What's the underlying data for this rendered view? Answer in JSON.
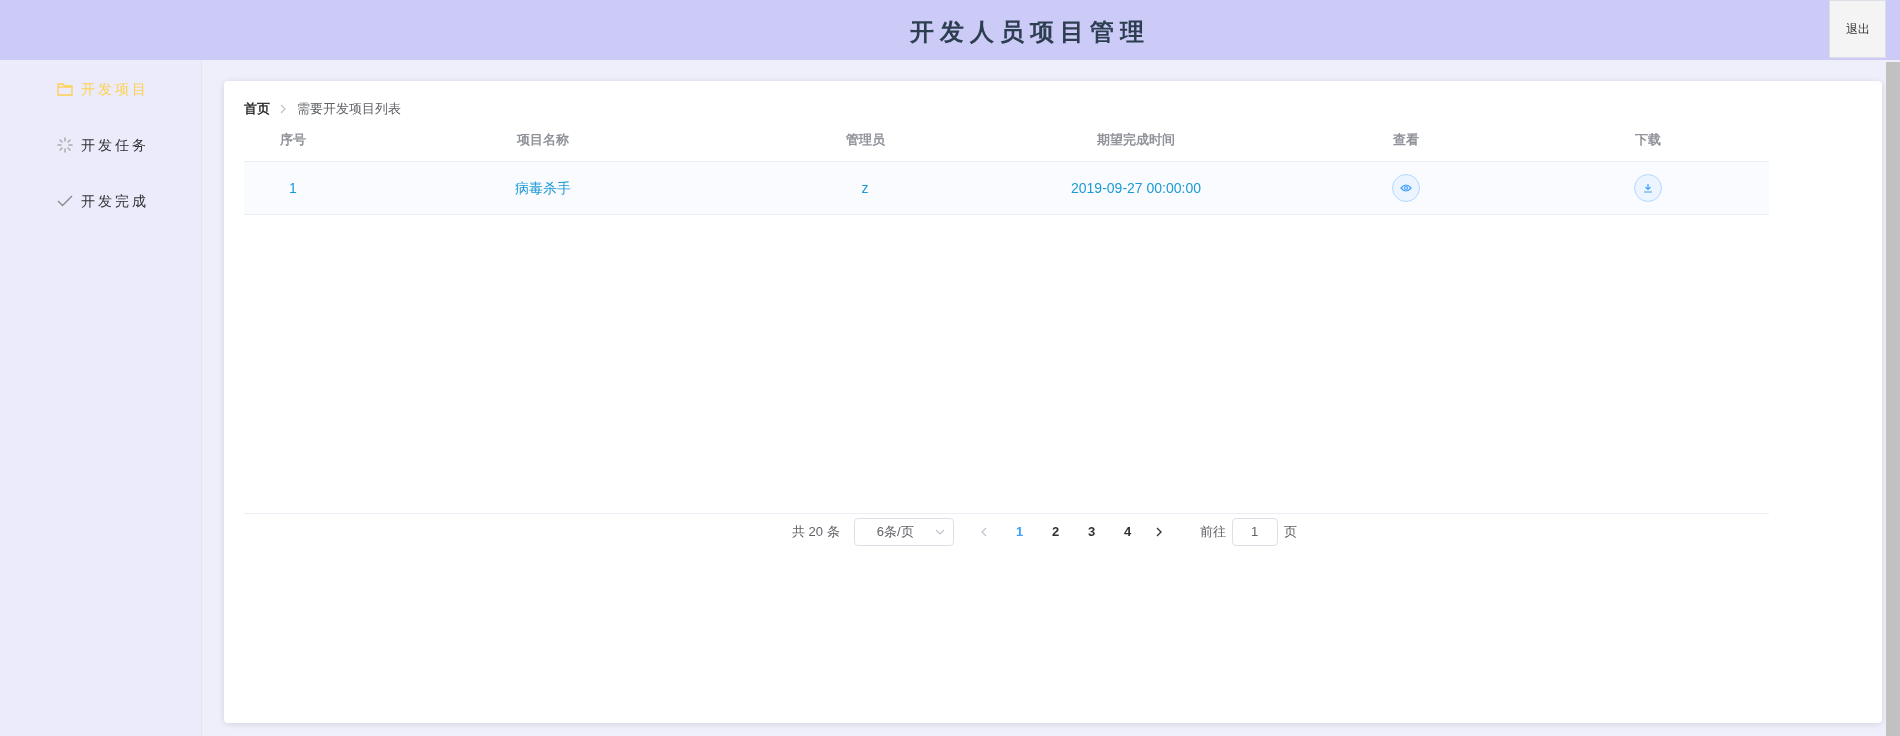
{
  "header": {
    "title": "开发人员项目管理",
    "logout": "退出"
  },
  "sidebar": {
    "items": [
      {
        "label": "开发项目",
        "selected": true
      },
      {
        "label": "开发任务",
        "selected": false
      },
      {
        "label": "开发完成",
        "selected": false
      }
    ]
  },
  "breadcrumb": [
    "首页",
    "需要开发项目列表"
  ],
  "table": {
    "columns": [
      "序号",
      "项目名称",
      "管理员",
      "期望完成时间",
      "查看",
      "下载"
    ],
    "rows": [
      {
        "index": "1",
        "name": "病毒杀手",
        "admin": "z",
        "due": "2019-09-27 00:00:00"
      }
    ]
  },
  "pagination": {
    "total": "共 20 条",
    "page_size": "6条/页",
    "pages": [
      {
        "label": "1",
        "selected": true
      },
      {
        "label": "2",
        "selected": false
      },
      {
        "label": "3",
        "selected": false
      },
      {
        "label": "4",
        "selected": false
      }
    ],
    "goto_label": "前往",
    "goto_value": "1",
    "goto_suffix": "页"
  }
}
